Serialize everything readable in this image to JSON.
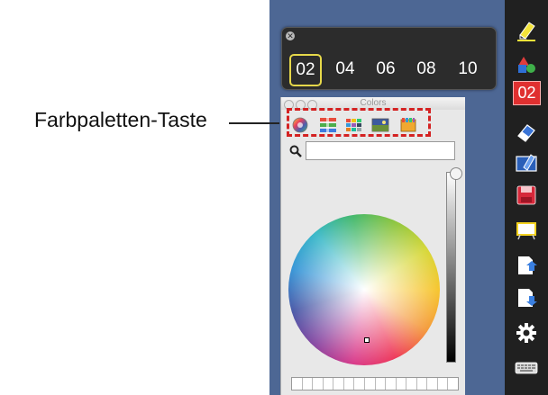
{
  "callout": {
    "label": "Farbpaletten-Taste"
  },
  "width_popup": {
    "options": [
      "02",
      "04",
      "06",
      "08",
      "10"
    ],
    "selected": "02",
    "close_glyph": "✕"
  },
  "colors_panel": {
    "title": "Colors",
    "tabs": [
      "color-wheel",
      "color-sliders",
      "color-palettes",
      "image-palettes",
      "crayons"
    ],
    "search": {
      "value": "",
      "placeholder": ""
    },
    "swatch_count": 16
  },
  "toolbar": {
    "items": [
      {
        "name": "highlighter-icon"
      },
      {
        "name": "shapes-icon"
      },
      {
        "name": "line-width-button",
        "label": "02"
      },
      {
        "name": "eraser-icon"
      },
      {
        "name": "clear-screen-icon"
      },
      {
        "name": "save-icon"
      },
      {
        "name": "whiteboard-icon"
      },
      {
        "name": "upload-icon"
      },
      {
        "name": "download-icon"
      },
      {
        "name": "settings-icon"
      },
      {
        "name": "keyboard-icon"
      }
    ]
  },
  "colors": {
    "desktop": "#4d6794",
    "toolbar": "#202020",
    "accent_red": "#e03030",
    "selection_yellow": "#e6d84a",
    "highlight_dashed": "#d42222"
  }
}
